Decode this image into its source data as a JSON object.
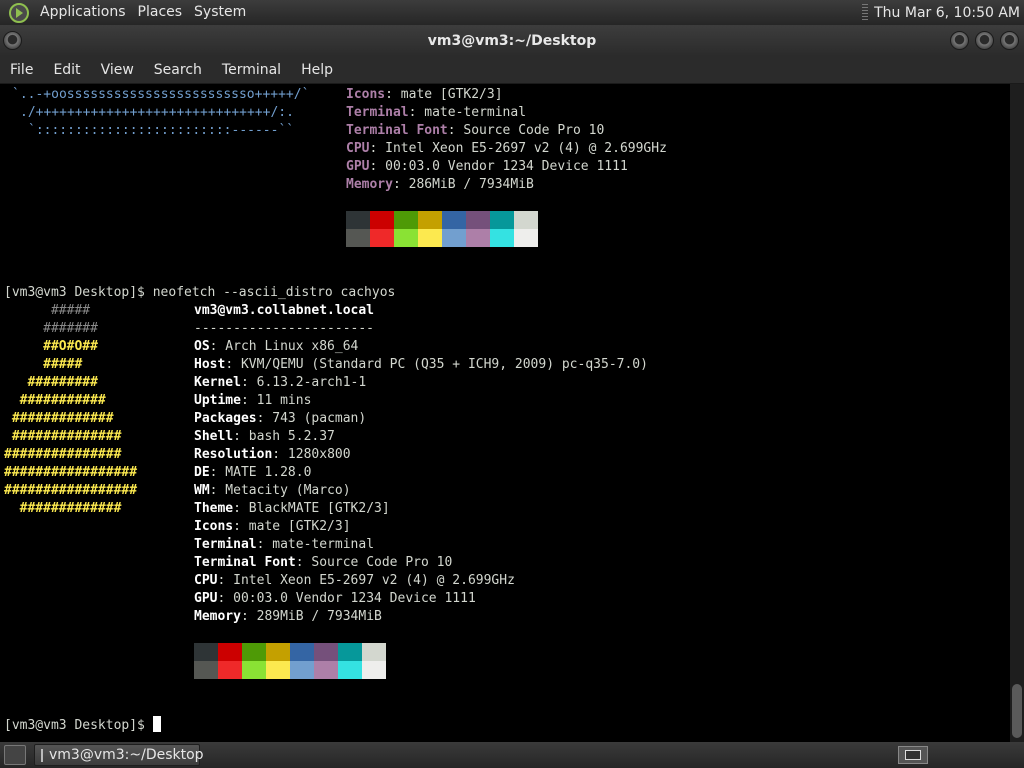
{
  "top_panel": {
    "menus": [
      "Applications",
      "Places",
      "System"
    ],
    "clock": "Thu Mar  6, 10:50 AM"
  },
  "window": {
    "title": "vm3@vm3:~/Desktop"
  },
  "menubar": [
    "File",
    "Edit",
    "View",
    "Search",
    "Terminal",
    "Help"
  ],
  "terminal": {
    "top_art": [
      "`..-+oossssssssssssssssssssssso+++++/`",
      "./++++++++++++++++++++++++++++++/:.",
      "`:::::::::::::::::::::::::------``"
    ],
    "top_info": [
      {
        "key": "Icons",
        "val": ": mate [GTK2/3]"
      },
      {
        "key": "Terminal",
        "val": ": mate-terminal"
      },
      {
        "key": "Terminal Font",
        "val": ": Source Code Pro 10"
      },
      {
        "key": "CPU",
        "val": ": Intel Xeon E5-2697 v2 (4) @ 2.699GHz"
      },
      {
        "key": "GPU",
        "val": ": 00:03.0 Vendor 1234 Device 1111"
      },
      {
        "key": "Memory",
        "val": ": 286MiB / 7934MiB"
      }
    ],
    "prompt": "[vm3@vm3 Desktop]$ ",
    "command": "neofetch --ascii_distro cachyos",
    "hostline": "vm3@vm3.collabnet.local",
    "separator": "-----------------------",
    "info": [
      {
        "key": "OS",
        "val": ": Arch Linux x86_64"
      },
      {
        "key": "Host",
        "val": ": KVM/QEMU (Standard PC (Q35 + ICH9, 2009) pc-q35-7.0)"
      },
      {
        "key": "Kernel",
        "val": ": 6.13.2-arch1-1"
      },
      {
        "key": "Uptime",
        "val": ": 11 mins"
      },
      {
        "key": "Packages",
        "val": ": 743 (pacman)"
      },
      {
        "key": "Shell",
        "val": ": bash 5.2.37"
      },
      {
        "key": "Resolution",
        "val": ": 1280x800"
      },
      {
        "key": "DE",
        "val": ": MATE 1.28.0"
      },
      {
        "key": "WM",
        "val": ": Metacity (Marco)"
      },
      {
        "key": "Theme",
        "val": ": BlackMATE [GTK2/3]"
      },
      {
        "key": "Icons",
        "val": ": mate [GTK2/3]"
      },
      {
        "key": "Terminal",
        "val": ": mate-terminal"
      },
      {
        "key": "Terminal Font",
        "val": ": Source Code Pro 10"
      },
      {
        "key": "CPU",
        "val": ": Intel Xeon E5-2697 v2 (4) @ 2.699GHz"
      },
      {
        "key": "GPU",
        "val": ": 00:03.0 Vendor 1234 Device 1111"
      },
      {
        "key": "Memory",
        "val": ": 289MiB / 7934MiB"
      }
    ],
    "art": [
      "      #####",
      "     #######",
      "     ##O#O##",
      "     #####",
      "   #########",
      "  ###########",
      " #############",
      " ##############",
      "###############",
      "#################",
      "#################",
      "  #############"
    ],
    "palette_dark": [
      "#2e3436",
      "#cc0000",
      "#4e9a06",
      "#c4a000",
      "#3465a4",
      "#75507b",
      "#06989a",
      "#d3d7cf"
    ],
    "palette_bright": [
      "#555753",
      "#ef2929",
      "#8ae234",
      "#fce94f",
      "#729fcf",
      "#ad7fa8",
      "#34e2e2",
      "#eeeeec"
    ]
  },
  "taskbar": {
    "item": "vm3@vm3:~/Desktop"
  }
}
